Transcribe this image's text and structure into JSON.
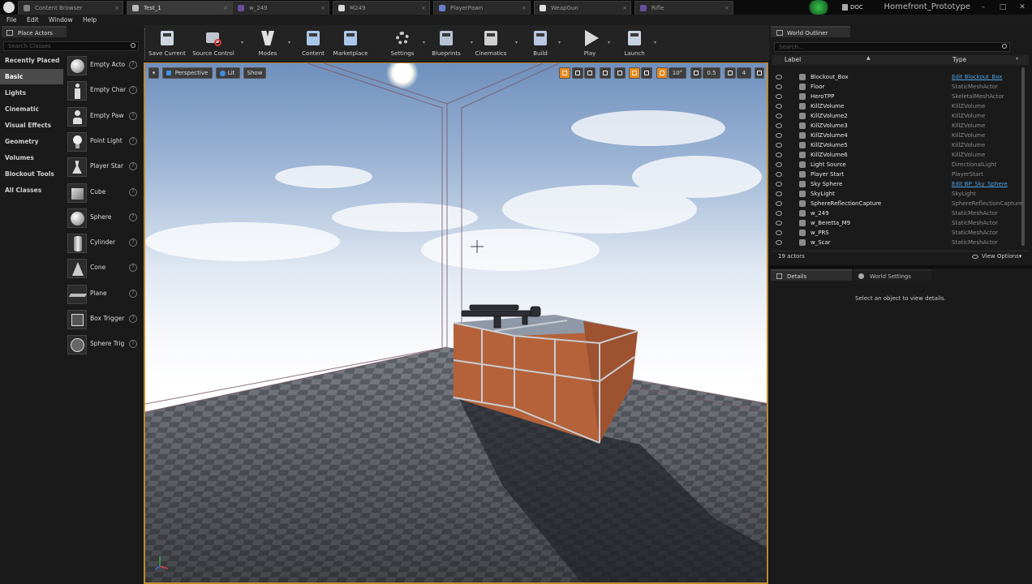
{
  "window": {
    "project_name": "Homefront_Prototype",
    "doc_button": "DOC",
    "tabs": [
      {
        "label": "Content Browser",
        "active": false
      },
      {
        "label": "Test_1",
        "active": true
      },
      {
        "label": "w_249",
        "active": false
      },
      {
        "label": "M249",
        "active": false
      },
      {
        "label": "PlayerPawn",
        "active": false
      },
      {
        "label": "WeapGun",
        "active": false
      },
      {
        "label": "Rifle",
        "active": false
      }
    ]
  },
  "menu": [
    "File",
    "Edit",
    "Window",
    "Help"
  ],
  "place_actors": {
    "title": "Place Actors",
    "search_placeholder": "Search Classes",
    "categories": [
      {
        "label": "Recently Placed",
        "selected": false
      },
      {
        "label": "Basic",
        "selected": true
      },
      {
        "label": "Lights",
        "selected": false
      },
      {
        "label": "Cinematic",
        "selected": false
      },
      {
        "label": "Visual Effects",
        "selected": false
      },
      {
        "label": "Geometry",
        "selected": false
      },
      {
        "label": "Volumes",
        "selected": false
      },
      {
        "label": "Blockout Tools",
        "selected": false
      },
      {
        "label": "All Classes",
        "selected": false
      }
    ],
    "items": [
      {
        "label": "Empty Acto",
        "icon": "sphere-icon"
      },
      {
        "label": "Empty Char",
        "icon": "character-icon"
      },
      {
        "label": "Empty Paw",
        "icon": "pawn-icon"
      },
      {
        "label": "Point Light",
        "icon": "light-bulb-icon"
      },
      {
        "label": "Player Star",
        "icon": "player-start-icon"
      },
      {
        "label": "Cube",
        "icon": "cube-icon"
      },
      {
        "label": "Sphere",
        "icon": "sphere-icon"
      },
      {
        "label": "Cylinder",
        "icon": "cylinder-icon"
      },
      {
        "label": "Cone",
        "icon": "cone-icon"
      },
      {
        "label": "Plane",
        "icon": "plane-icon"
      },
      {
        "label": "Box Trigger",
        "icon": "box-trigger-icon"
      },
      {
        "label": "Sphere Trig",
        "icon": "sphere-trigger-icon"
      }
    ]
  },
  "toolbar": [
    {
      "label": "Save Current",
      "icon": "save-icon",
      "dropdown": false
    },
    {
      "label": "Source Control",
      "icon": "source-control-icon",
      "dropdown": true
    },
    {
      "label": "Modes",
      "icon": "modes-icon",
      "dropdown": true
    },
    {
      "label": "Content",
      "icon": "content-icon",
      "dropdown": false
    },
    {
      "label": "Marketplace",
      "icon": "marketplace-icon",
      "dropdown": false
    },
    {
      "label": "Settings",
      "icon": "settings-icon",
      "dropdown": true
    },
    {
      "label": "Blueprints",
      "icon": "blueprints-icon",
      "dropdown": true
    },
    {
      "label": "Cinematics",
      "icon": "cinematics-icon",
      "dropdown": true
    },
    {
      "label": "Build",
      "icon": "build-icon",
      "dropdown": true
    },
    {
      "label": "Play",
      "icon": "play-icon",
      "dropdown": true
    },
    {
      "label": "Launch",
      "icon": "launch-icon",
      "dropdown": true
    }
  ],
  "viewport": {
    "perspective_label": "Perspective",
    "lit_label": "Lit",
    "show_label": "Show",
    "rotation_snap": "10°",
    "scale_snap": "0.5",
    "camera_speed": "4",
    "accent_color": "#e8891a"
  },
  "world_outliner": {
    "title": "World Outliner",
    "search_placeholder": "Search...",
    "col_label": "Label",
    "col_type": "Type",
    "rows": [
      {
        "name": "Blockout_Box",
        "type": "Edit Blockout_Box",
        "type_link": true
      },
      {
        "name": "Floor",
        "type": "StaticMeshActor",
        "type_link": false
      },
      {
        "name": "HeroTPP",
        "type": "SkeletalMeshActor",
        "type_link": false
      },
      {
        "name": "KillZVolume",
        "type": "KillZVolume",
        "type_link": false
      },
      {
        "name": "KillZVolume2",
        "type": "KillZVolume",
        "type_link": false
      },
      {
        "name": "KillZVolume3",
        "type": "KillZVolume",
        "type_link": false
      },
      {
        "name": "KillZVolume4",
        "type": "KillZVolume",
        "type_link": false
      },
      {
        "name": "KillZVolume5",
        "type": "KillZVolume",
        "type_link": false
      },
      {
        "name": "KillZVolume6",
        "type": "KillZVolume",
        "type_link": false
      },
      {
        "name": "Light Source",
        "type": "DirectionalLight",
        "type_link": false
      },
      {
        "name": "Player Start",
        "type": "PlayerStart",
        "type_link": false
      },
      {
        "name": "Sky Sphere",
        "type": "Edit BP_Sky_Sphere",
        "type_link": true
      },
      {
        "name": "SkyLight",
        "type": "SkyLight",
        "type_link": false
      },
      {
        "name": "SphereReflectionCapture",
        "type": "SphereReflectionCapture",
        "type_link": false
      },
      {
        "name": "w_249",
        "type": "StaticMeshActor",
        "type_link": false
      },
      {
        "name": "w_Beretta_M9",
        "type": "StaticMeshActor",
        "type_link": false
      },
      {
        "name": "w_PRS",
        "type": "StaticMeshActor",
        "type_link": false
      },
      {
        "name": "w_Scar",
        "type": "StaticMeshActor",
        "type_link": false
      }
    ],
    "actor_count": "19 actors",
    "view_options": "View Options"
  },
  "details": {
    "tab_details": "Details",
    "tab_world_settings": "World Settings",
    "empty_message": "Select an object to view details."
  }
}
